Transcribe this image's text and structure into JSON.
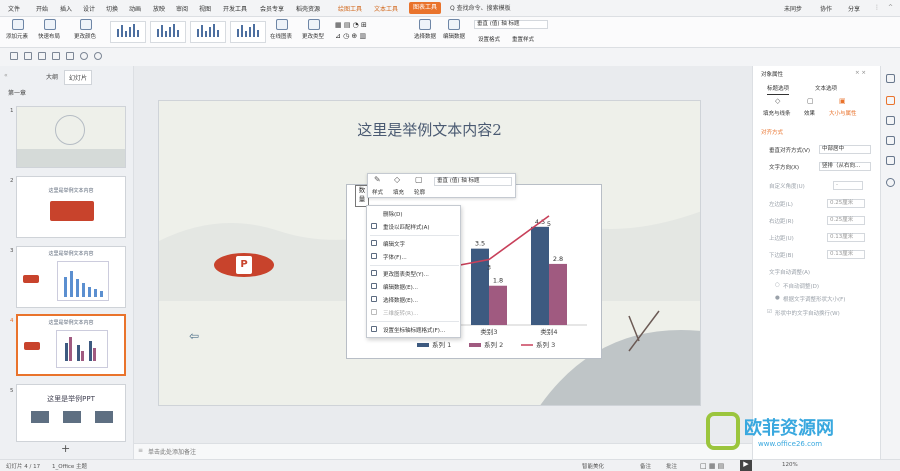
{
  "menubar": {
    "items": [
      "文件",
      "开始",
      "插入",
      "设计",
      "切换",
      "动画",
      "放映",
      "审阅",
      "视图",
      "开发工具",
      "会员专享",
      "稻壳资源"
    ],
    "context_tabs": [
      "绘图工具",
      "文本工具"
    ],
    "active_tab": "图表工具",
    "search": "Q 查找命令、搜索模板",
    "right_items": [
      "未同步",
      "协作",
      "分享"
    ]
  },
  "ribbon": {
    "buttons": [
      "添加元素",
      "快速布局",
      "更改颜色",
      "在线图表",
      "更改类型",
      "选择数据",
      "编辑数据",
      "设置格式",
      "重置样式"
    ],
    "element_dropdown": "垂直 (值) 轴 标题"
  },
  "left_panel": {
    "tabs": [
      "大纲",
      "幻灯片"
    ],
    "section": "第一章",
    "slides": [
      {
        "num": "1",
        "title": ""
      },
      {
        "num": "2",
        "title": "这里是举例文本内容"
      },
      {
        "num": "3",
        "title": "这里是举例文本内容"
      },
      {
        "num": "4",
        "title": "这里是举例文本内容"
      },
      {
        "num": "5",
        "title": "这里是举例PPT"
      }
    ],
    "add_icon": "+"
  },
  "slide": {
    "title": "这里是举例文本内容2"
  },
  "chart_data": {
    "type": "bar",
    "categories": [
      "类别2",
      "类别3",
      "类别4"
    ],
    "visible_category_labels": [
      "2",
      "类别3",
      "类别4"
    ],
    "series": [
      {
        "name": "系列 1",
        "values": [
          null,
          3.5,
          4.5
        ],
        "color": "#3d5a80",
        "kind": "bar"
      },
      {
        "name": "系列 2",
        "values": [
          4.4,
          1.8,
          2.8
        ],
        "color": "#a05a80",
        "kind": "bar"
      },
      {
        "name": "系列 3",
        "values": [
          null,
          3,
          5
        ],
        "color": "#c8405a",
        "kind": "line"
      }
    ],
    "data_labels": [
      "4.4",
      "3.5",
      "1.8",
      "3",
      "4.5",
      "2.8",
      "5"
    ],
    "legend": [
      "系列 1",
      "系列 2",
      "系列 3"
    ],
    "legend_position": "bottom",
    "ylim": [
      0,
      5.5
    ]
  },
  "axis_title_box": "数\n量",
  "mini_toolbar": {
    "style_label": "样式",
    "fill_label": "填充",
    "outline_label": "轮廓",
    "element_select": "垂直 (值) 轴 标题"
  },
  "context_menu": {
    "items": [
      {
        "label": "删除(D)",
        "disabled": false
      },
      {
        "label": "重设以匹配样式(A)",
        "disabled": false
      },
      {
        "label": "编辑文字",
        "disabled": false
      },
      {
        "label": "字体(F)...",
        "disabled": false
      },
      {
        "label": "更改图表类型(Y)...",
        "disabled": false
      },
      {
        "label": "编辑数据(E)...",
        "disabled": false
      },
      {
        "label": "选择数据(E)...",
        "disabled": false
      },
      {
        "label": "三维旋转(R)...",
        "disabled": true
      },
      {
        "label": "设置坐标轴标题格式(F)...",
        "disabled": false
      }
    ]
  },
  "right_panel": {
    "title": "对象属性",
    "tabs": [
      "标题选项",
      "文本选项"
    ],
    "subtabs": [
      "填充与线条",
      "效果",
      "大小与属性"
    ],
    "section": "对齐方式",
    "rows": [
      {
        "label": "垂直对齐方式(V)",
        "value": "中部居中"
      },
      {
        "label": "文字方向(X)",
        "value": "竖排（从右向..."
      },
      {
        "label": "自定义角度(U)",
        "value": "-"
      },
      {
        "label": "左边距(L)",
        "value": "0.25厘米"
      },
      {
        "label": "右边距(R)",
        "value": "0.25厘米"
      },
      {
        "label": "上边距(U)",
        "value": "0.13厘米"
      },
      {
        "label": "下边距(B)",
        "value": "0.13厘米"
      }
    ],
    "autofit_label": "文字自动调整(A)",
    "options": [
      "不自动调整(D)",
      "根据文字调整形状大小(F)",
      "形状中的文字自动换行(W)"
    ]
  },
  "notes_placeholder": "单击此处添加备注",
  "statusbar": {
    "slide_count": "幻灯片 4 / 17",
    "theme": "1_Office 主题",
    "beautify": "智能美化",
    "notes": "备注",
    "comments": "批注",
    "zoom": "120%"
  },
  "watermark": {
    "text": "欧菲资源网",
    "url": "www.office26.com"
  }
}
